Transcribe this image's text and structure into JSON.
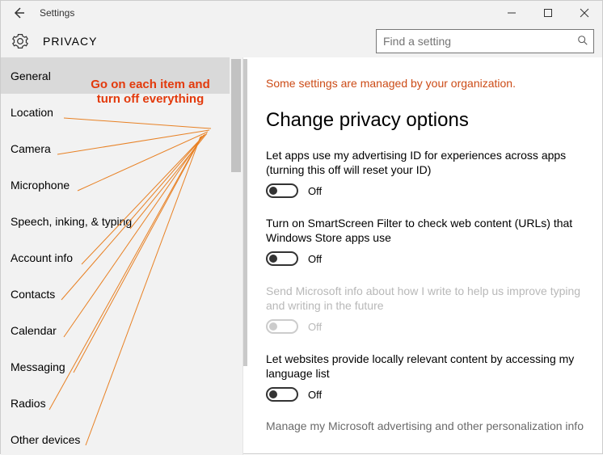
{
  "titlebar": {
    "title": "Settings"
  },
  "header": {
    "heading": "PRIVACY"
  },
  "search": {
    "placeholder": "Find a setting"
  },
  "sidebar": {
    "items": [
      {
        "label": "General",
        "selected": true
      },
      {
        "label": "Location",
        "selected": false
      },
      {
        "label": "Camera",
        "selected": false
      },
      {
        "label": "Microphone",
        "selected": false
      },
      {
        "label": "Speech, inking, & typing",
        "selected": false
      },
      {
        "label": "Account info",
        "selected": false
      },
      {
        "label": "Contacts",
        "selected": false
      },
      {
        "label": "Calendar",
        "selected": false
      },
      {
        "label": "Messaging",
        "selected": false
      },
      {
        "label": "Radios",
        "selected": false
      },
      {
        "label": "Other devices",
        "selected": false
      }
    ]
  },
  "content": {
    "org_notice": "Some settings are managed by your organization.",
    "section_title": "Change privacy options",
    "options": [
      {
        "label": "Let apps use my advertising ID for experiences across apps (turning this off will reset your ID)",
        "state": "Off",
        "disabled": false
      },
      {
        "label": "Turn on SmartScreen Filter to check web content (URLs) that Windows Store apps use",
        "state": "Off",
        "disabled": false
      },
      {
        "label": "Send Microsoft info about how I write to help us improve typing and writing in the future",
        "state": "Off",
        "disabled": true
      },
      {
        "label": "Let websites provide locally relevant content by accessing my language list",
        "state": "Off",
        "disabled": false
      }
    ],
    "footer_link": "Manage my Microsoft advertising and other personalization info"
  },
  "annotation": {
    "text1": "Go on each item and",
    "text2": "turn off everything"
  }
}
